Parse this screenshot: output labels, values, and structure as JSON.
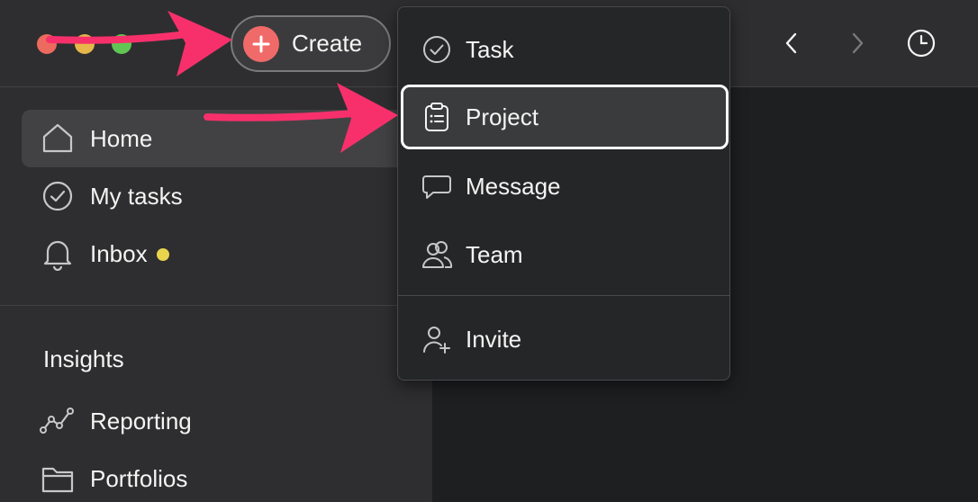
{
  "window": {
    "controls": [
      "close",
      "minimize",
      "zoom"
    ]
  },
  "toolbar": {
    "create_label": "Create",
    "create_icon": "plus-icon",
    "back_icon": "chevron-left-icon",
    "forward_icon": "chevron-right-icon",
    "history_icon": "clock-icon"
  },
  "sidebar": {
    "items": [
      {
        "label": "Home",
        "icon": "home-icon",
        "active": true
      },
      {
        "label": "My tasks",
        "icon": "check-circle-icon"
      },
      {
        "label": "Inbox",
        "icon": "bell-icon",
        "unread": true
      }
    ],
    "insights": {
      "title": "Insights",
      "items": [
        {
          "label": "Reporting",
          "icon": "line-chart-icon"
        },
        {
          "label": "Portfolios",
          "icon": "folder-icon"
        }
      ]
    }
  },
  "create_menu": {
    "items": [
      {
        "label": "Task",
        "icon": "check-circle-icon"
      },
      {
        "label": "Project",
        "icon": "clipboard-icon",
        "highlighted": true
      },
      {
        "label": "Message",
        "icon": "speech-bubble-icon"
      },
      {
        "label": "Team",
        "icon": "people-icon"
      }
    ],
    "footer_items": [
      {
        "label": "Invite",
        "icon": "person-add-icon"
      }
    ]
  },
  "colors": {
    "accent_create": "#f06a6a",
    "annotation_arrow": "#f7306c",
    "unread_dot": "#e8d44d",
    "sidebar_bg": "#2e2e30",
    "main_bg": "#1e1f21",
    "menu_bg": "#252628"
  }
}
